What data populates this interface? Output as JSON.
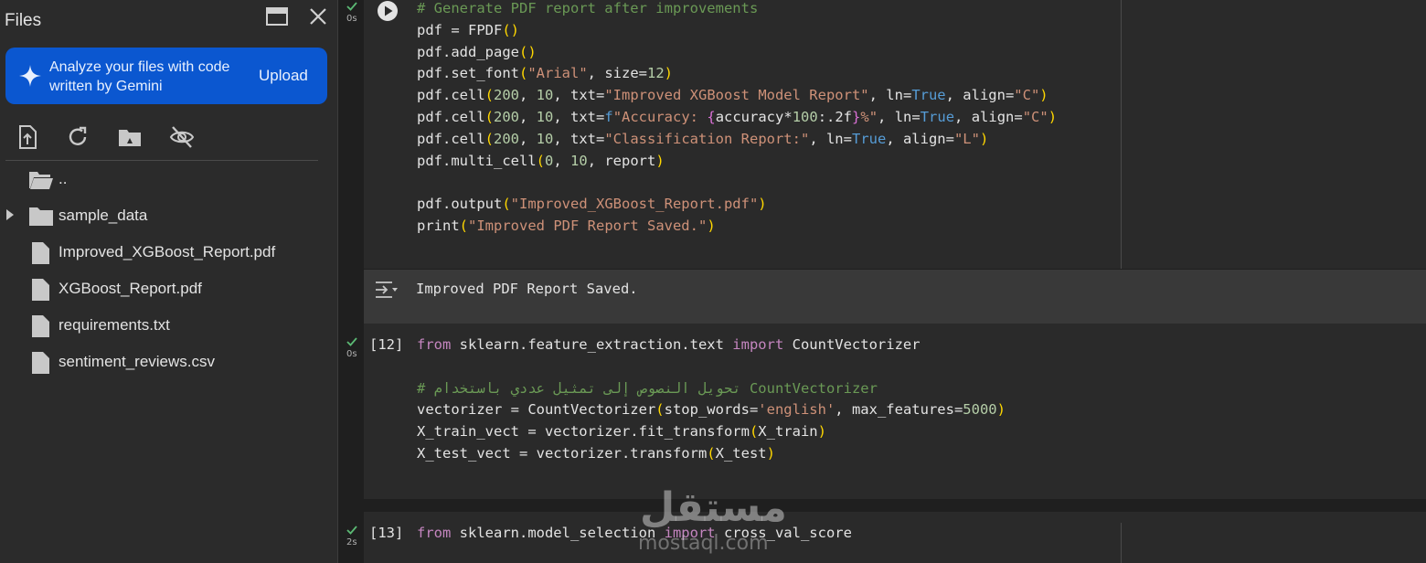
{
  "sidebar": {
    "title": "Files",
    "gemini_text": "Analyze your files with code written by Gemini",
    "upload_label": "Upload",
    "tree": [
      {
        "label": "..",
        "type": "folder-open"
      },
      {
        "label": "sample_data",
        "type": "folder"
      },
      {
        "label": "Improved_XGBoost_Report.pdf",
        "type": "file"
      },
      {
        "label": "XGBoost_Report.pdf",
        "type": "file"
      },
      {
        "label": "requirements.txt",
        "type": "file"
      },
      {
        "label": "sentiment_reviews.csv",
        "type": "file"
      }
    ]
  },
  "cells": [
    {
      "exec": "",
      "time": "0s"
    },
    {
      "exec": "[12]",
      "time": "0s"
    },
    {
      "exec": "[13]",
      "time": "2s"
    }
  ],
  "output": {
    "text": "Improved PDF Report Saved."
  },
  "watermark": {
    "arabic": "مستقل",
    "latin": "mostaql.com"
  },
  "colors": {
    "accent": "#0b57d0",
    "check": "#5bb974"
  }
}
